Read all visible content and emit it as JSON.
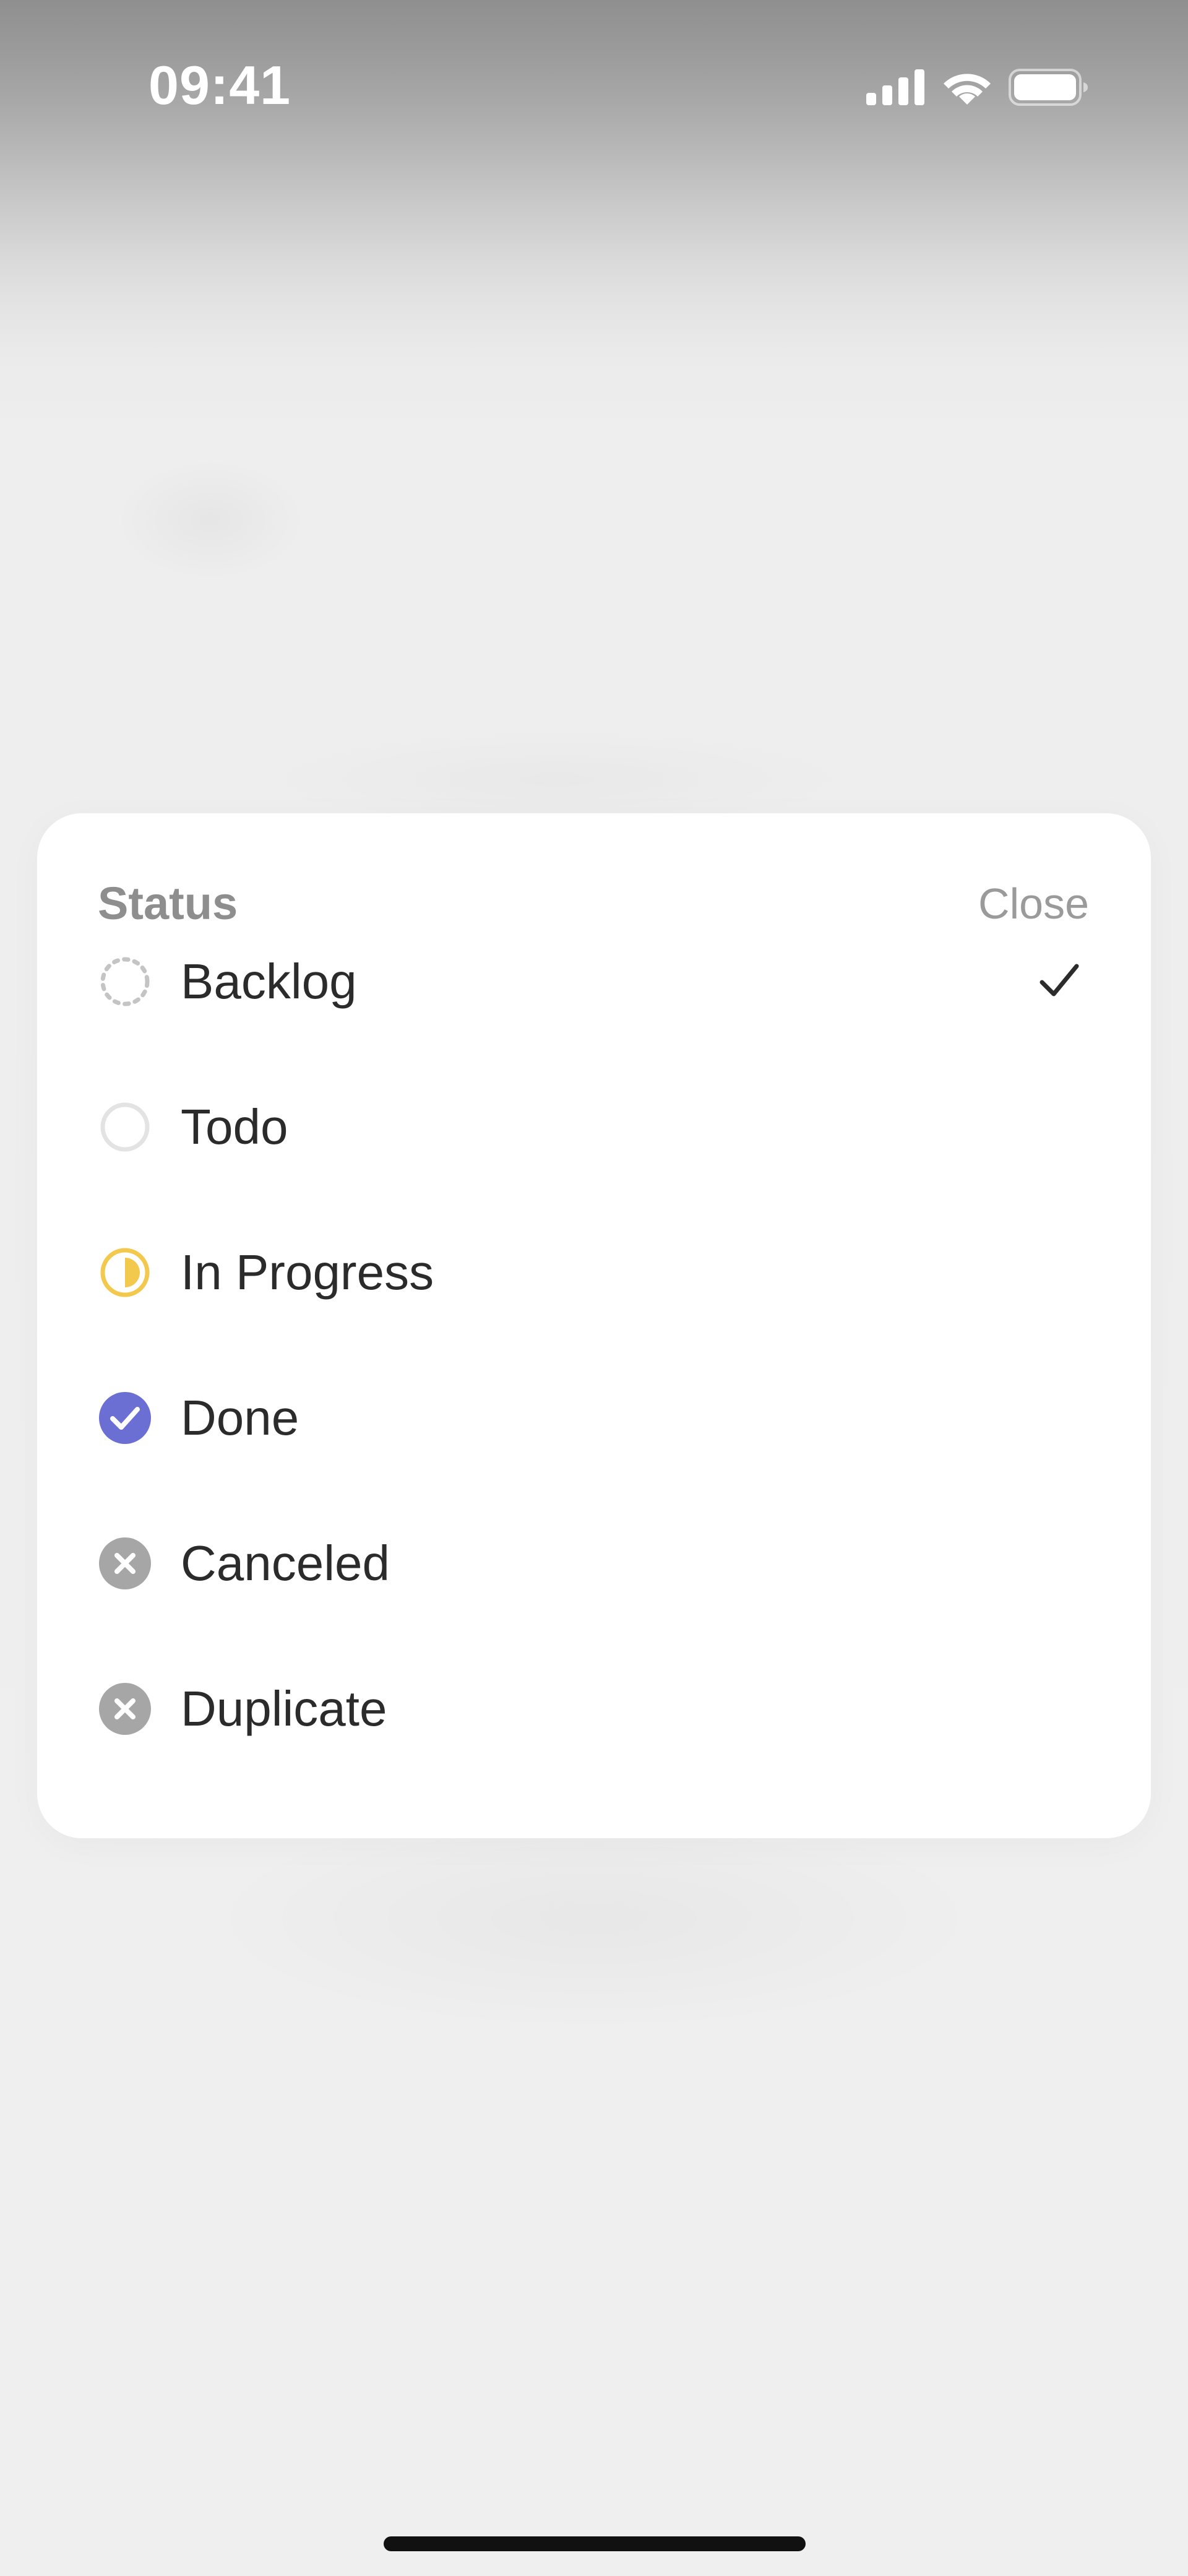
{
  "status_bar": {
    "time": "09:41",
    "icons": [
      "cellular-signal-icon",
      "wifi-icon",
      "battery-icon"
    ],
    "battery_level": 1.0
  },
  "sheet": {
    "title": "Status",
    "close_label": "Close",
    "options": [
      {
        "label": "Backlog",
        "icon": "backlog-dashed-circle-icon",
        "color": "#c4c4c4",
        "selected": true
      },
      {
        "label": "Todo",
        "icon": "todo-empty-circle-icon",
        "color": "#e3e3e3",
        "selected": false
      },
      {
        "label": "In Progress",
        "icon": "in-progress-half-circle-icon",
        "color": "#f2c94c",
        "selected": false
      },
      {
        "label": "Done",
        "icon": "done-check-circle-icon",
        "color": "#6b6fd4",
        "selected": false
      },
      {
        "label": "Canceled",
        "icon": "canceled-x-circle-icon",
        "color": "#a6a6a6",
        "selected": false
      },
      {
        "label": "Duplicate",
        "icon": "duplicate-x-circle-icon",
        "color": "#a6a6a6",
        "selected": false
      }
    ]
  },
  "colors": {
    "sheet_background": "#ffffff",
    "text_primary": "#2b2b2b",
    "text_secondary": "#8e8e8e",
    "selected_check": "#2b2b2b"
  }
}
